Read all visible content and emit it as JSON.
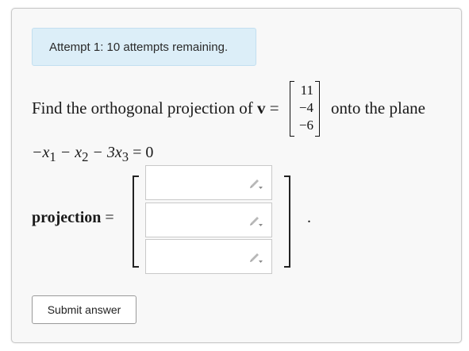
{
  "attempt_banner": "Attempt 1: 10 attempts remaining.",
  "question": {
    "prefix": "Find the orthogonal projection of ",
    "vector_symbol": "v",
    "equals": " =",
    "vector_entries": [
      "11",
      "−4",
      "−6"
    ],
    "suffix": "onto the plane",
    "plane_equation": {
      "t1": "−x",
      "s1": "1",
      "t2": " − x",
      "s2": "2",
      "t3": " − 3x",
      "s3": "3",
      "rhs": " = 0"
    }
  },
  "answer": {
    "label": "projection",
    "equals": " =",
    "inputs": [
      {
        "value": "",
        "icon": "pencil-dropdown-icon"
      },
      {
        "value": "",
        "icon": "pencil-dropdown-icon"
      },
      {
        "value": "",
        "icon": "pencil-dropdown-icon"
      }
    ],
    "terminator": "."
  },
  "submit_label": "Submit answer"
}
